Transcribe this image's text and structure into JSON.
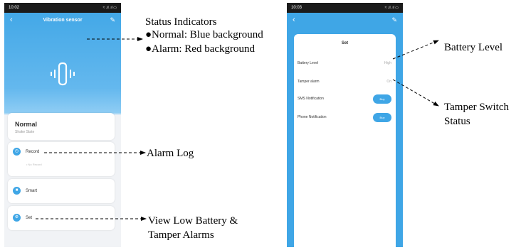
{
  "left_screen": {
    "time": "10:02",
    "signal": "≈ .ıl .ıl ▭",
    "back_icon": "chevron-left-icon",
    "title": "Vibration sensor",
    "edit_icon": "pencil-icon",
    "status": {
      "state": "Normal",
      "subtitle": "Shake State"
    },
    "menu": [
      {
        "label": "Record",
        "icon": "clock-icon",
        "empty_text": "• No Record"
      },
      {
        "label": "Smart",
        "icon": "smart-icon"
      },
      {
        "label": "Set",
        "icon": "gear-icon"
      }
    ],
    "accent": "#3fa6e6"
  },
  "right_screen": {
    "time": "10:03",
    "signal": "≈ .ıl .ıl ▭",
    "back_icon": "chevron-left-icon",
    "edit_icon": "pencil-icon",
    "panel_title": "Set",
    "rows": [
      {
        "label": "Battery Level",
        "value": "High"
      },
      {
        "label": "Tamper alarm",
        "value": "On"
      },
      {
        "label": "SMS Notification",
        "button": "Buy"
      },
      {
        "label": "Phone Notification",
        "button": "Buy"
      }
    ]
  },
  "annotations": {
    "status_title": "Status Indicators",
    "status_normal": "●Normal: Blue background",
    "status_alarm": "●Alarm: Red background",
    "alarm_log": "Alarm  Log",
    "low_battery_1": "View  Low  Battery  &",
    "low_battery_2": "Tamper Alarms",
    "battery_level": "Battery Level",
    "tamper_1": "Tamper   Switch",
    "tamper_2": "Status"
  }
}
